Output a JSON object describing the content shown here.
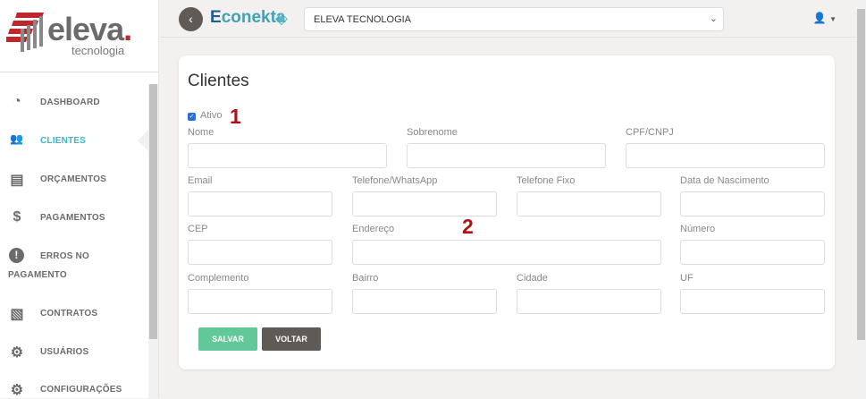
{
  "logo": {
    "name": "eleva",
    "dot": ".",
    "sub": "tecnologia"
  },
  "sidebar": {
    "items": [
      {
        "label": "DASHBOARD",
        "icon": "dashboard-icon",
        "glyph": "◔"
      },
      {
        "label": "CLIENTES",
        "icon": "users-icon",
        "glyph": "👥"
      },
      {
        "label": "ORÇAMENTOS",
        "icon": "receipt-icon",
        "glyph": "▤"
      },
      {
        "label": "PAGAMENTOS",
        "icon": "hand-dollar-icon",
        "glyph": "$"
      },
      {
        "label": "ERROS NO",
        "label2": "PAGAMENTO",
        "icon": "exclamation-circle-icon",
        "glyph": "!"
      },
      {
        "label": "CONTRATOS",
        "icon": "contract-icon",
        "glyph": "▧"
      },
      {
        "label": "USUÁRIOS",
        "icon": "users-cog-icon",
        "glyph": "⚙"
      },
      {
        "label": "CONFIGURAÇÕES",
        "icon": "gear-icon",
        "glyph": "⚙"
      }
    ]
  },
  "header": {
    "brand_e": "E",
    "brand_rest": "conekta",
    "company": "ELEVA TECNOLOGIA"
  },
  "form": {
    "title": "Clientes",
    "ativo_label": "Ativo",
    "ativo_checked": true,
    "annotations": [
      "1",
      "2"
    ],
    "fields": {
      "nome": "Nome",
      "sobrenome": "Sobrenome",
      "cpf": "CPF/CNPJ",
      "email": "Email",
      "whatsapp": "Telefone/WhatsApp",
      "fixo": "Telefone Fixo",
      "nascimento": "Data de Nascimento",
      "cep": "CEP",
      "endereco": "Endereço",
      "numero": "Número",
      "complemento": "Complemento",
      "bairro": "Bairro",
      "cidade": "Cidade",
      "uf": "UF"
    },
    "save": "SALVAR",
    "back": "VOLTAR"
  },
  "colors": {
    "accent": "#3fb4c4",
    "save": "#62c799",
    "back": "#5f5a55"
  }
}
